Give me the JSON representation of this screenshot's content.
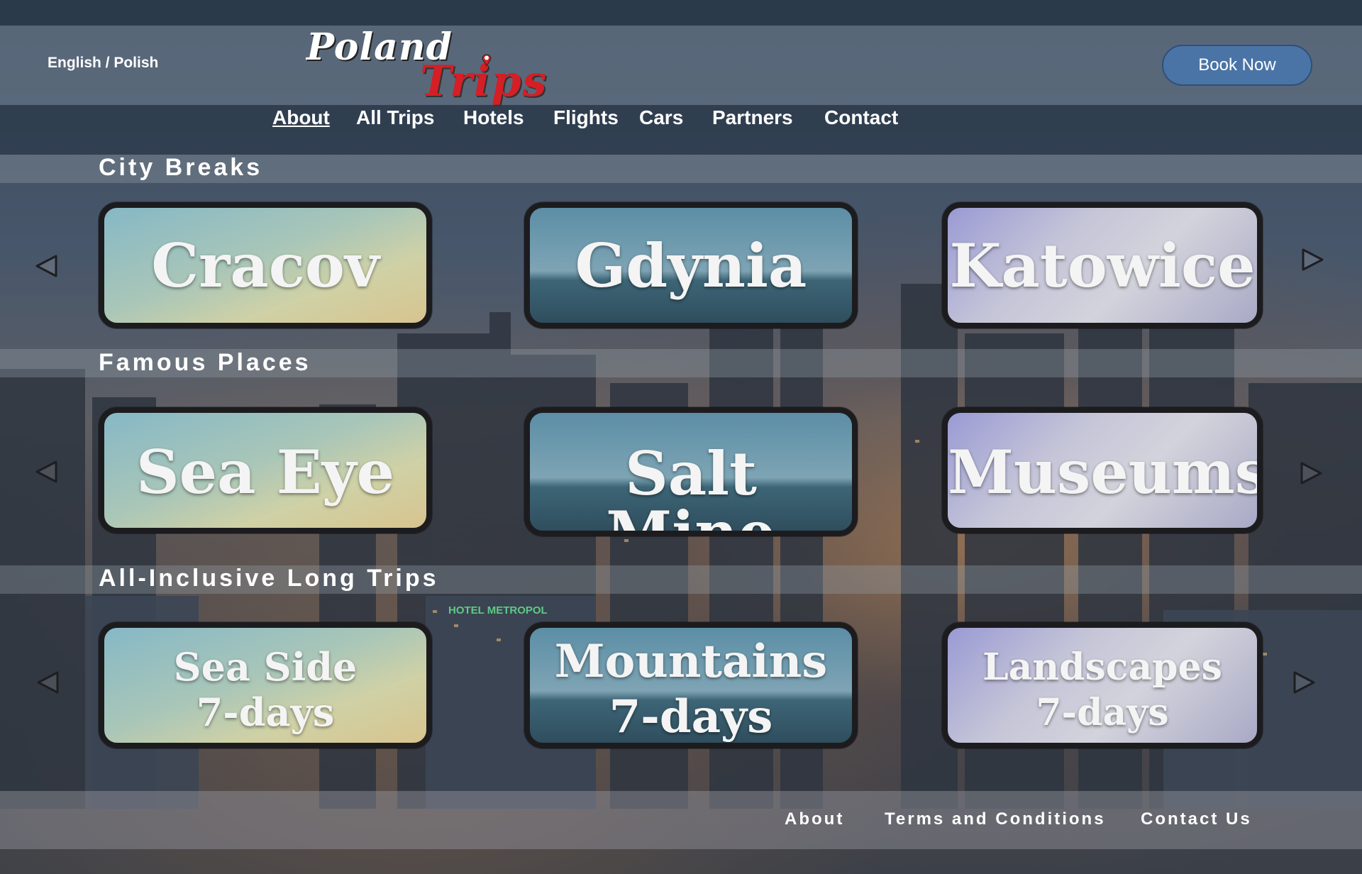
{
  "header": {
    "language": "English / Polish",
    "logo": {
      "line1": "Poland",
      "line2": "Trips"
    },
    "book_button": "Book Now"
  },
  "nav": {
    "items": [
      {
        "label": "About",
        "active": true
      },
      {
        "label": "All Trips"
      },
      {
        "label": "Hotels"
      },
      {
        "label": "Flights"
      },
      {
        "label": "Cars"
      },
      {
        "label": "Partners"
      },
      {
        "label": "Contact"
      }
    ]
  },
  "sections": [
    {
      "title": "City Breaks",
      "cards": [
        {
          "label": "Cracov"
        },
        {
          "label": "Gdynia"
        },
        {
          "label": "Katowice"
        }
      ]
    },
    {
      "title": "Famous Places",
      "cards": [
        {
          "label": "Sea Eye"
        },
        {
          "label": "Salt Mine"
        },
        {
          "label": "Museums"
        }
      ]
    },
    {
      "title": "All-Inclusive Long Trips",
      "cards": [
        {
          "label": "Sea Side",
          "sub": "7-days"
        },
        {
          "label": "Mountains",
          "sub": "7-days"
        },
        {
          "label": "Landscapes",
          "sub": "7-days"
        }
      ]
    }
  ],
  "background_sign": "HOTEL METROPOL",
  "footer": {
    "links": [
      "About",
      "Terms and Conditions",
      "Contact Us"
    ]
  },
  "icons": {
    "prev": "chevron-left-icon",
    "next": "chevron-right-icon",
    "pin": "map-pin-icon"
  },
  "colors": {
    "book_button": "#4a74a6",
    "logo_red": "#d41f26"
  }
}
